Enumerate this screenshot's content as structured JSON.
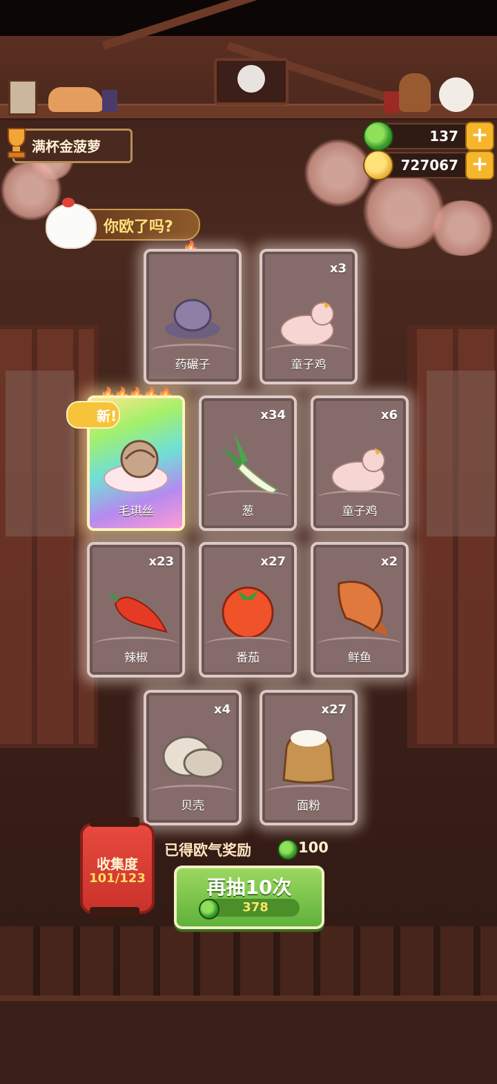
{
  "header": {
    "title": "满杯金菠萝",
    "gems": "137",
    "coins": "727067",
    "add_label": "+"
  },
  "speech": {
    "text": "你欧了吗?"
  },
  "cards": [
    {
      "name": "药碾子",
      "count": "",
      "icon": "herb-grinder-icon"
    },
    {
      "name": "童子鸡",
      "count": "x3",
      "icon": "chick-icon"
    },
    {
      "name": "毛琪丝",
      "count": "",
      "icon": "hermit-crab-icon",
      "tag": "新!",
      "special": true
    },
    {
      "name": "葱",
      "count": "x34",
      "icon": "scallion-icon"
    },
    {
      "name": "童子鸡",
      "count": "x6",
      "icon": "chick-icon"
    },
    {
      "name": "辣椒",
      "count": "x23",
      "icon": "chili-icon"
    },
    {
      "name": "番茄",
      "count": "x27",
      "icon": "tomato-icon"
    },
    {
      "name": "鲜鱼",
      "count": "x2",
      "icon": "fish-icon"
    },
    {
      "name": "贝壳",
      "count": "x4",
      "icon": "shell-icon"
    },
    {
      "name": "面粉",
      "count": "x27",
      "icon": "flour-sack-icon"
    }
  ],
  "collection": {
    "label": "收集度",
    "value": "101/123"
  },
  "reward": {
    "label": "已得欧气奖励",
    "value": "100"
  },
  "draw_button": {
    "label": "再抽10次",
    "cost": "378"
  },
  "colors": {
    "accent_green": "#5fb13b",
    "gold": "#f6b62b",
    "card_bg": "#856c6a"
  }
}
